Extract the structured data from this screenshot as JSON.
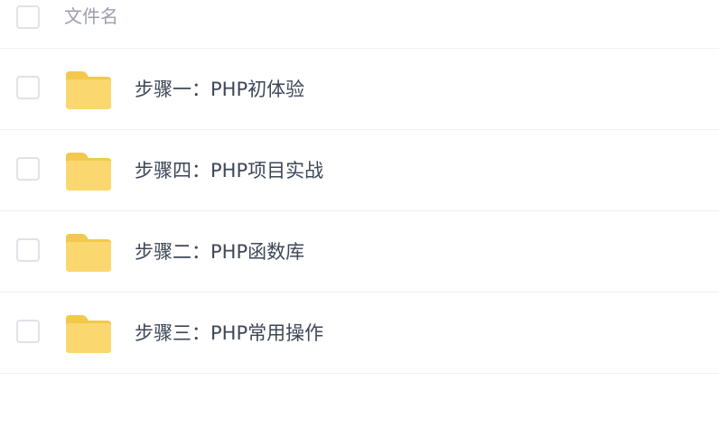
{
  "header": {
    "column_label": "文件名"
  },
  "files": [
    {
      "name": "步骤一：PHP初体验",
      "icon": "folder-icon"
    },
    {
      "name": "步骤四：PHP项目实战",
      "icon": "folder-icon"
    },
    {
      "name": "步骤二：PHP函数库",
      "icon": "folder-icon"
    },
    {
      "name": "步骤三：PHP常用操作",
      "icon": "folder-icon"
    }
  ],
  "colors": {
    "folder_fill": "#fbd86f",
    "folder_tab": "#f2c94c",
    "text": "#3d4757",
    "muted_text": "#9aa0ab",
    "divider": "#eef0f4",
    "checkbox_border": "#dfe2e8"
  }
}
